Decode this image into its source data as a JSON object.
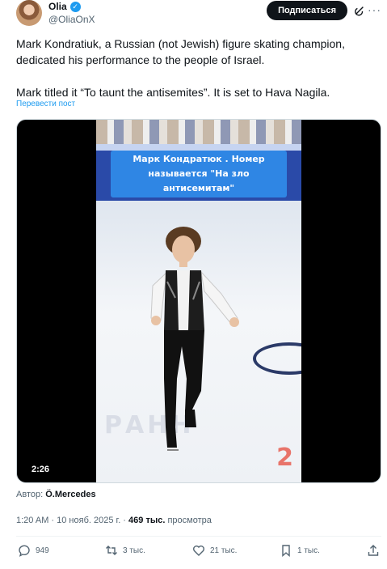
{
  "author": {
    "display_name": "Olia",
    "handle": "@OliaOnX",
    "subscribe_label": "Подписаться"
  },
  "tweet": {
    "paragraph1": "Mark Kondratiuk, a Russian (not Jewish) figure skating champion, dedicated his performance to the people of Israel.",
    "paragraph2": "Mark titled it “To taunt the antisemites”. It is set to Hava Nagila.",
    "translate_label": "Перевести пост"
  },
  "media": {
    "caption_line1": "Марк Кондратюк . Номер",
    "caption_line2": "называется \"На зло антисемитам\"",
    "rink_text": "РАНН",
    "rink_number": "2",
    "duration": "2:26"
  },
  "attribution": {
    "prefix": "Автор:",
    "name": "Ö.Mercedes"
  },
  "meta": {
    "time": "1:20 AM",
    "separator": " · ",
    "date": "10 нояб. 2025 г.",
    "views_count": "469 тыс.",
    "views_label": "просмотра"
  },
  "actions": {
    "replies": "949",
    "reposts": "3 тыс.",
    "likes": "21 тыс.",
    "bookmarks": "1 тыс."
  },
  "colors": {
    "accent": "#1d9bf0",
    "text": "#0f1419",
    "secondary": "#536471"
  },
  "icons": {
    "verified": "verified-badge-icon",
    "grok": "grok-icon",
    "more": "more-icon",
    "reply": "reply-icon",
    "repost": "repost-icon",
    "like": "heart-icon",
    "bookmark": "bookmark-icon",
    "share": "share-icon"
  }
}
